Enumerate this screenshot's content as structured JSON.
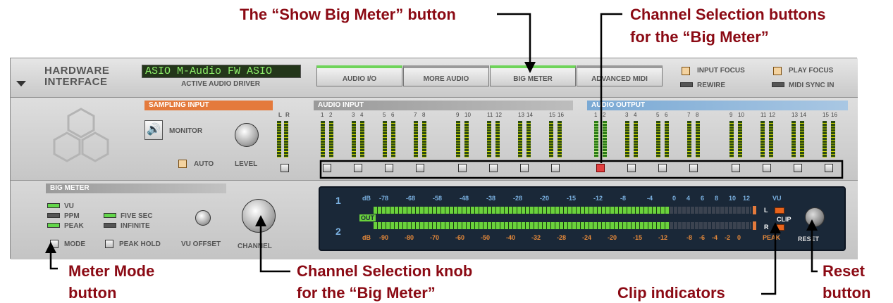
{
  "callouts": {
    "show_big_meter": "The “Show Big Meter” button",
    "channel_buttons_1": "Channel Selection buttons",
    "channel_buttons_2": "for the “Big Meter”",
    "meter_mode_1": "Meter Mode",
    "meter_mode_2": "button",
    "channel_knob_1": "Channel Selection knob",
    "channel_knob_2": "for the “Big Meter”",
    "clip_indicators": "Clip indicators",
    "reset_1": "Reset",
    "reset_2": "button"
  },
  "header": {
    "title_1": "HARDWARE",
    "title_2": "INTERFACE",
    "driver_lcd": "ASIO M-Audio FW ASIO",
    "driver_caption": "ACTIVE AUDIO DRIVER",
    "tabs": [
      "AUDIO I/O",
      "MORE AUDIO",
      "BIG METER",
      "ADVANCED MIDI"
    ],
    "input_focus": "INPUT FOCUS",
    "play_focus": "PLAY FOCUS",
    "rewire": "REWIRE",
    "midi_sync_in": "MIDI SYNC IN"
  },
  "sampling": {
    "title": "SAMPLING INPUT",
    "monitor": "MONITOR",
    "auto": "AUTO",
    "level": "LEVEL",
    "l": "L",
    "r": "R"
  },
  "audio_input": {
    "title": "AUDIO INPUT",
    "channels": [
      "1",
      "2",
      "3",
      "4",
      "5",
      "6",
      "7",
      "8",
      "9",
      "10",
      "11",
      "12",
      "13",
      "14",
      "15",
      "16"
    ]
  },
  "audio_output": {
    "title": "AUDIO OUTPUT",
    "channels": [
      "1",
      "2",
      "3",
      "4",
      "5",
      "6",
      "7",
      "8",
      "9",
      "10",
      "11",
      "12",
      "13",
      "14",
      "15",
      "16"
    ]
  },
  "big_meter": {
    "title": "BIG METER",
    "vu": "VU",
    "ppm": "PPM",
    "peak": "PEAK",
    "five_sec": "FIVE SEC",
    "infinite": "INFINITE",
    "mode": "MODE",
    "peak_hold": "PEAK HOLD",
    "vu_offset": "VU OFFSET",
    "channel": "CHANNEL",
    "ch1": "1",
    "ch2": "2",
    "out": "OUT",
    "db": "dB",
    "top_scale": [
      "-78",
      "-68",
      "-58",
      "-48",
      "-38",
      "-28",
      "-20",
      "-15",
      "-12",
      "-8",
      "-4",
      "0",
      "4",
      "6",
      "8",
      "10",
      "12"
    ],
    "top_unit": "VU",
    "bottom_scale": [
      "-90",
      "-80",
      "-70",
      "-60",
      "-50",
      "-40",
      "-32",
      "-28",
      "-24",
      "-20",
      "-15",
      "-12",
      "-8",
      "-6",
      "-4",
      "-2",
      "0"
    ],
    "bottom_unit": "PEAK",
    "l": "L",
    "r": "R",
    "clip": "CLIP",
    "reset": "RESET"
  }
}
